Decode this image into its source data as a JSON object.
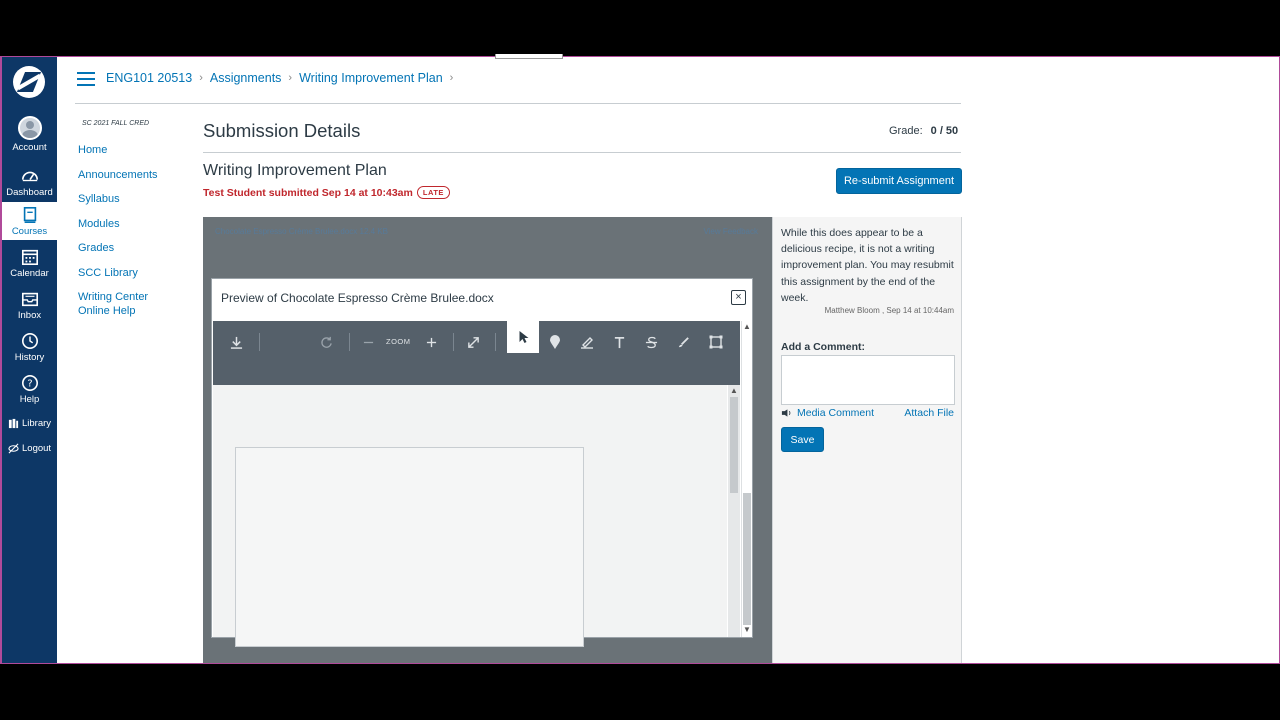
{
  "global_nav": {
    "items": [
      {
        "label": "Account",
        "icon": "account-icon"
      },
      {
        "label": "Dashboard",
        "icon": "dashboard-icon"
      },
      {
        "label": "Courses",
        "icon": "courses-icon",
        "active": true
      },
      {
        "label": "Calendar",
        "icon": "calendar-icon"
      },
      {
        "label": "Inbox",
        "icon": "inbox-icon"
      },
      {
        "label": "History",
        "icon": "history-icon"
      },
      {
        "label": "Help",
        "icon": "help-icon"
      }
    ],
    "library": "Library",
    "logout": "Logout"
  },
  "breadcrumb": {
    "course": "ENG101 20513",
    "section": "Assignments",
    "page": "Writing Improvement Plan"
  },
  "course_nav": {
    "term": "SC 2021 FALL CRED",
    "items": [
      "Home",
      "Announcements",
      "Syllabus",
      "Modules",
      "Grades",
      "SCC Library",
      "Writing Center Online Help"
    ]
  },
  "main": {
    "title": "Submission Details",
    "grade_label": "Grade:",
    "grade_value": "0 / 50",
    "assignment_name": "Writing Improvement Plan",
    "submitted_text": "Test Student submitted Sep 14 at 10:43am",
    "late_badge": "LATE",
    "resubmit_label": "Re-submit Assignment"
  },
  "preview": {
    "file_line": "Chocolate Espresso Crème Brulee.docx   12.4 KB",
    "view_feedback": "View Feedback",
    "dialog_title": "Preview of Chocolate Espresso Crème Brulee.docx",
    "close_symbol": "×",
    "zoom_label": "ZOOM"
  },
  "comments": {
    "text": "While this does appear to be a delicious recipe, it is not a writing improvement plan. You may resubmit this assignment by the end of the week.",
    "meta": "Matthew Bloom , Sep 14 at 10:44am",
    "add_label": "Add a Comment:",
    "media_label": "Media Comment",
    "attach_label": "Attach File",
    "save_label": "Save"
  },
  "colors": {
    "nav_bg": "#0d3766",
    "link": "#0374b5",
    "late_red": "#c0272d"
  }
}
